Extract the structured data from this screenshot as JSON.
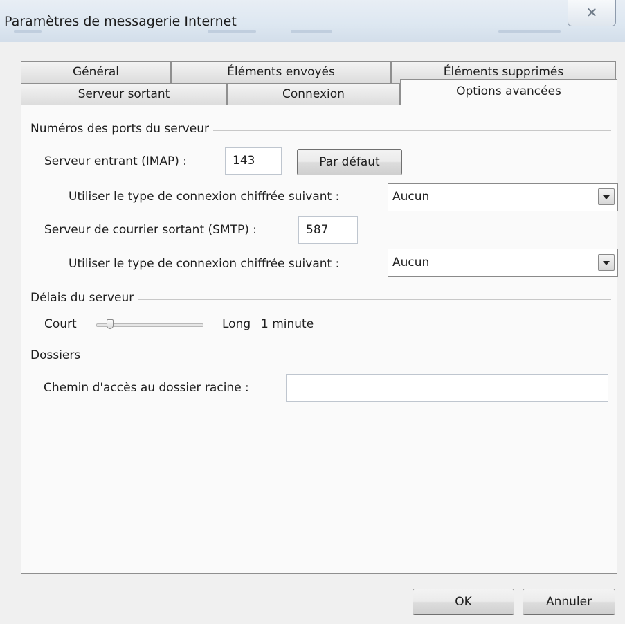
{
  "window": {
    "title": "Paramètres de messagerie Internet",
    "close_glyph": "✕"
  },
  "tabs": {
    "row1": [
      "Général",
      "Éléments envoyés",
      "Éléments supprimés"
    ],
    "row2": [
      "Serveur sortant",
      "Connexion",
      "Options avancées"
    ],
    "active": "Options avancées"
  },
  "ports": {
    "group_label": "Numéros des ports du serveur",
    "incoming_label": "Serveur entrant (IMAP) :",
    "incoming_value": "143",
    "default_button": "Par défaut",
    "encryption_label_1": "Utiliser le type de connexion chiffrée suivant :",
    "encryption_value_1": "Aucun",
    "outgoing_label": "Serveur de courrier sortant (SMTP) :",
    "outgoing_value": "587",
    "encryption_label_2": "Utiliser le type de connexion chiffrée suivant :",
    "encryption_value_2": "Aucun"
  },
  "timeouts": {
    "group_label": "Délais du serveur",
    "short_label": "Court",
    "long_label": "Long",
    "value_text": "1 minute",
    "slider_level": 0.1
  },
  "folders": {
    "group_label": "Dossiers",
    "root_path_label": "Chemin d'accès au dossier racine :",
    "root_path_value": ""
  },
  "buttons": {
    "ok": "OK",
    "cancel": "Annuler"
  },
  "icons": {
    "close": "close-icon",
    "dropdown": "chevron-down-icon"
  }
}
